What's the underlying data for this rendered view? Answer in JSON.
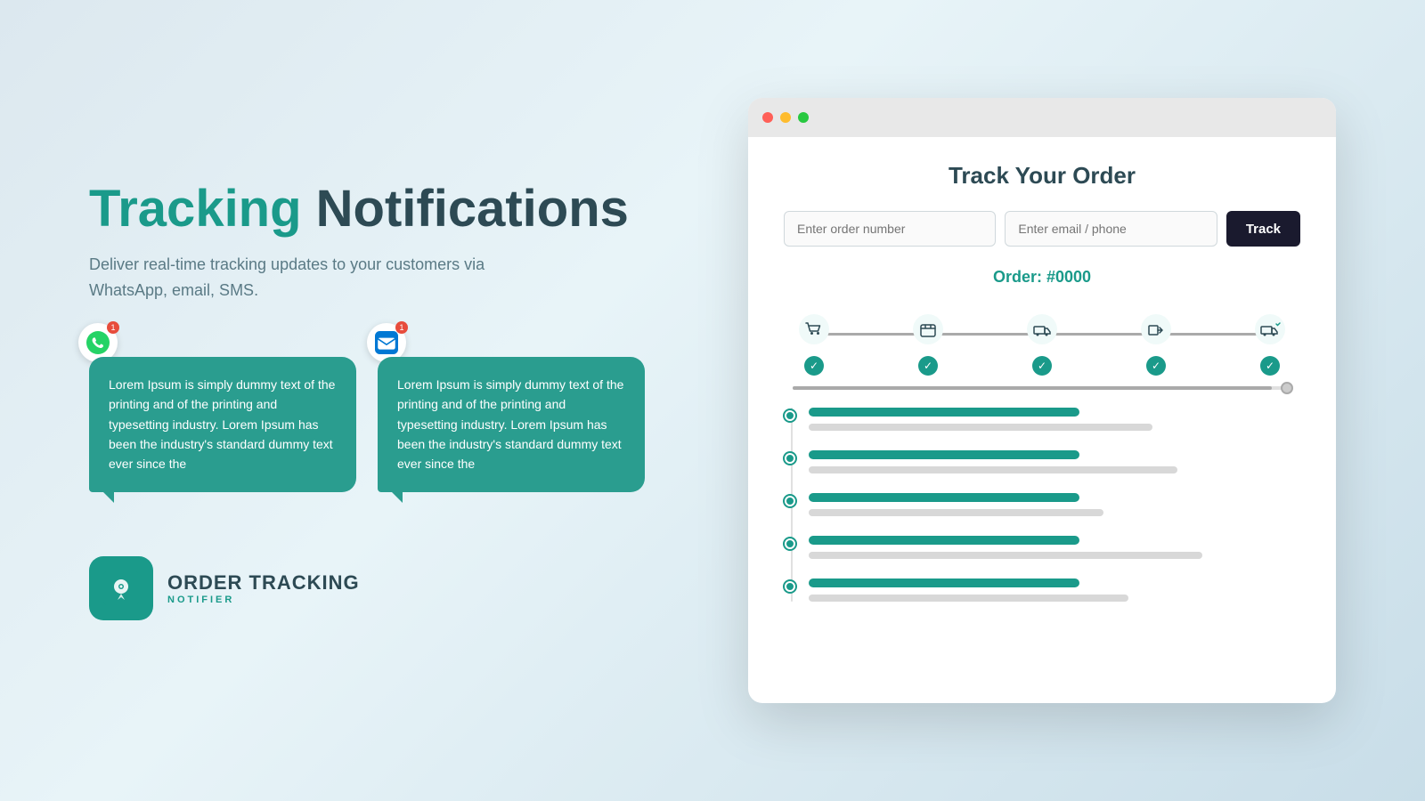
{
  "hero": {
    "title_highlight": "Tracking",
    "title_rest": " Notifications",
    "subtitle_line1": "Deliver real-time tracking updates to your customers via",
    "subtitle_line2": "WhatsApp, email, SMS."
  },
  "chat_bubbles": [
    {
      "icon": "whatsapp",
      "text": "Lorem Ipsum is simply dummy text of the printing and of the printing and typesetting industry. Lorem Ipsum has been the industry's standard dummy text ever since the"
    },
    {
      "icon": "email",
      "text": "Lorem Ipsum is simply dummy text of the printing and of the printing and typesetting industry. Lorem Ipsum has been the industry's standard dummy text ever since the"
    }
  ],
  "brand": {
    "name": "ORDER TRACKING",
    "sub": "NOTIFIER"
  },
  "browser": {
    "title": "Track Your Order",
    "input1_placeholder": "Enter order number",
    "input2_placeholder": "Enter email / phone",
    "track_button": "Track",
    "order_number": "Order: #0000",
    "steps": [
      {
        "icon": "🛒",
        "checked": true
      },
      {
        "icon": "📦",
        "checked": true
      },
      {
        "icon": "🚚",
        "checked": true
      },
      {
        "icon": "📋",
        "checked": true
      },
      {
        "icon": "🚛",
        "checked": true
      }
    ],
    "timeline": [
      {
        "bar1_width": "55%",
        "bar2_width": "70%"
      },
      {
        "bar1_width": "55%",
        "bar2_width": "75%"
      },
      {
        "bar1_width": "55%",
        "bar2_width": "60%"
      },
      {
        "bar1_width": "55%",
        "bar2_width": "80%"
      },
      {
        "bar1_width": "55%",
        "bar2_width": "65%"
      }
    ]
  },
  "colors": {
    "teal": "#1a9a8a",
    "dark": "#2d4a54",
    "track_btn": "#1a1a2e"
  }
}
